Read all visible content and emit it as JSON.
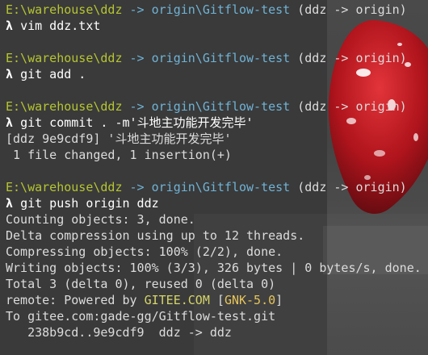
{
  "terminal": {
    "lines": [
      {
        "type": "prompt",
        "path": "E:\\warehouse\\ddz",
        "branch": "-> origin\\Gitflow-test",
        "suffix": "(ddz -> origin)"
      },
      {
        "type": "command",
        "prompt": "λ",
        "text": "vim ddz.txt"
      },
      {
        "type": "blank"
      },
      {
        "type": "prompt",
        "path": "E:\\warehouse\\ddz",
        "branch": "-> origin\\Gitflow-test",
        "suffix": "(ddz -> origin)"
      },
      {
        "type": "command",
        "prompt": "λ",
        "text": "git add ."
      },
      {
        "type": "blank"
      },
      {
        "type": "prompt",
        "path": "E:\\warehouse\\ddz",
        "branch": "-> origin\\Gitflow-test",
        "suffix": "(ddz -> origin)"
      },
      {
        "type": "command",
        "prompt": "λ",
        "text": "git commit . -m'斗地主功能开发完毕'"
      },
      {
        "type": "output",
        "text": "[ddz 9e9cdf9] '斗地主功能开发完毕'"
      },
      {
        "type": "output",
        "text": " 1 file changed, 1 insertion(+)"
      },
      {
        "type": "blank"
      },
      {
        "type": "prompt",
        "path": "E:\\warehouse\\ddz",
        "branch": "-> origin\\Gitflow-test",
        "suffix": "(ddz -> origin)"
      },
      {
        "type": "command",
        "prompt": "λ",
        "text": "git push origin ddz"
      },
      {
        "type": "output",
        "text": "Counting objects: 3, done."
      },
      {
        "type": "output",
        "text": "Delta compression using up to 12 threads."
      },
      {
        "type": "output",
        "text": "Compressing objects: 100% (2/2), done."
      },
      {
        "type": "output",
        "text": "Writing objects: 100% (3/3), 326 bytes | 0 bytes/s, done."
      },
      {
        "type": "output",
        "text": "Total 3 (delta 0), reused 0 (delta 0)"
      },
      {
        "type": "remote",
        "pre": "remote: Powered by ",
        "hl1": "GITEE.COM",
        "mid": " [",
        "hl2": "GNK-5.0",
        "post": "]"
      },
      {
        "type": "output",
        "text": "To gitee.com:gade-gg/Gitflow-test.git"
      },
      {
        "type": "output",
        "text": "   238b9cd..9e9cdf9  ddz -> ddz"
      }
    ]
  },
  "colors": {
    "path": "#b5c531",
    "branch": "#6fb3d6",
    "text": "#e6e6e6",
    "highlight": "#d5d56a",
    "background": "#3a3a3a"
  }
}
